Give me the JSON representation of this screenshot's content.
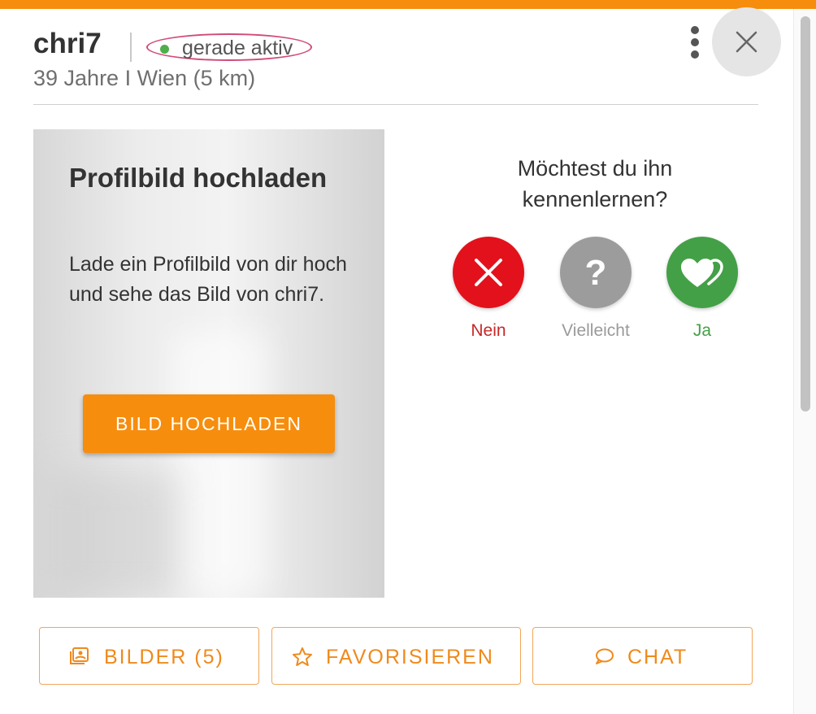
{
  "colors": {
    "accent": "#f78d0c",
    "no": "#e3111b",
    "maybe": "#9c9c9c",
    "yes": "#43a047",
    "online": "#4fae4c"
  },
  "profile": {
    "username": "chri7",
    "status": "gerade aktiv",
    "meta": "39 Jahre I Wien (5 km)"
  },
  "header": {
    "menu_icon": "kebab-menu-icon",
    "close_icon": "close-icon"
  },
  "upload_card": {
    "title": "Profilbild hochladen",
    "text": "Lade ein Profilbild von dir hoch und sehe das Bild von chri7.",
    "button_label": "BILD HOCHLADEN"
  },
  "vote": {
    "question": "Möchtest du ihn kennenlernen?",
    "options": [
      {
        "label": "Nein",
        "icon": "x-icon"
      },
      {
        "label": "Vielleicht",
        "icon": "question-icon"
      },
      {
        "label": "Ja",
        "icon": "hearts-icon"
      }
    ]
  },
  "actions": [
    {
      "label": "BILDER (5)",
      "icon": "photos-icon"
    },
    {
      "label": "FAVORISIEREN",
      "icon": "star-icon"
    },
    {
      "label": "CHAT",
      "icon": "chat-bubble-icon"
    }
  ]
}
